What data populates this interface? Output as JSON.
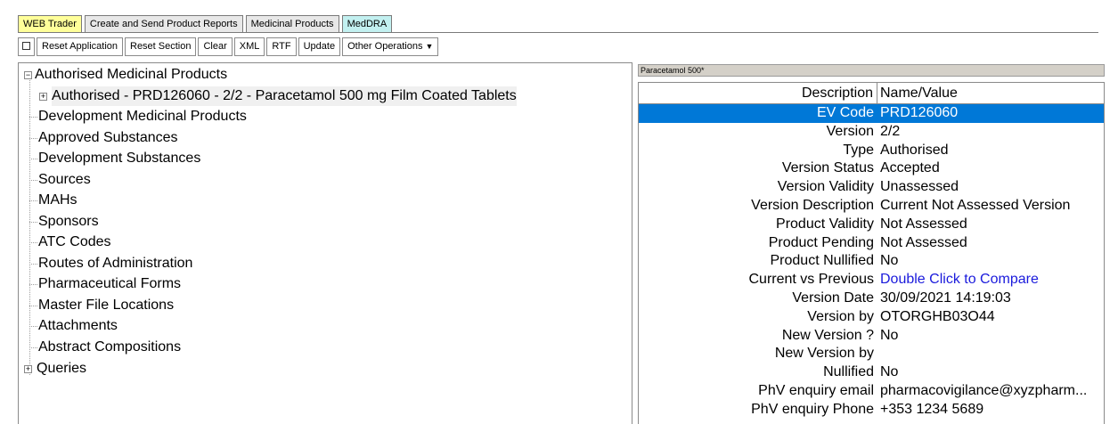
{
  "tabs": [
    {
      "label": "WEB Trader"
    },
    {
      "label": "Create and Send Product Reports"
    },
    {
      "label": "Medicinal Products"
    },
    {
      "label": "MedDRA"
    }
  ],
  "toolbar": {
    "reset_application": "Reset Application",
    "reset_section": "Reset Section",
    "clear": "Clear",
    "xml": "XML",
    "rtf": "RTF",
    "update": "Update",
    "other_operations": "Other Operations",
    "caret": "▼"
  },
  "tree": {
    "expanded_glyph": "−",
    "collapsed_glyph": "+",
    "root": "Authorised Medicinal Products",
    "child": "Authorised - PRD126060 - 2/2 - Paracetamol 500 mg Film Coated Tablets",
    "items": [
      "Development Medicinal Products",
      "Approved Substances",
      "Development Substances",
      "Sources",
      "MAHs",
      "Sponsors",
      "ATC Codes",
      "Routes of Administration",
      "Pharmaceutical Forms",
      "Master File Locations",
      "Attachments",
      "Abstract Compositions"
    ],
    "queries": "Queries"
  },
  "panel": {
    "title": "Paracetamol 500*",
    "col_description": "Description",
    "col_value": "Name/Value",
    "rows": [
      {
        "d": "EV Code",
        "v": "PRD126060"
      },
      {
        "d": "Version",
        "v": "2/2"
      },
      {
        "d": "Type",
        "v": "Authorised"
      },
      {
        "d": "Version Status",
        "v": "Accepted"
      },
      {
        "d": "Version Validity",
        "v": "Unassessed"
      },
      {
        "d": "Version Description",
        "v": "Current Not Assessed Version"
      },
      {
        "d": "Product Validity",
        "v": "Not Assessed"
      },
      {
        "d": "Product Pending",
        "v": "Not Assessed"
      },
      {
        "d": "Product Nullified",
        "v": "No"
      },
      {
        "d": "Current vs Previous",
        "v": "Double Click to Compare"
      },
      {
        "d": "Version Date",
        "v": "30/09/2021 14:19:03"
      },
      {
        "d": "Version by",
        "v": "OTORGHB03O44"
      },
      {
        "d": "New Version ?",
        "v": "No"
      },
      {
        "d": "New Version by",
        "v": ""
      },
      {
        "d": "Nullified",
        "v": "No"
      },
      {
        "d": "PhV enquiry email",
        "v": "pharmacovigilance@xyzpharm..."
      },
      {
        "d": "PhV enquiry Phone",
        "v": "+353 1234 5689"
      }
    ]
  }
}
